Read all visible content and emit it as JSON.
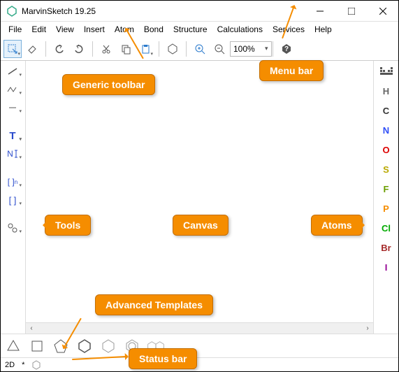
{
  "window": {
    "title": "MarvinSketch 19.25"
  },
  "menu": [
    "File",
    "Edit",
    "View",
    "Insert",
    "Atom",
    "Bond",
    "Structure",
    "Calculations",
    "Services",
    "Help"
  ],
  "toolbar": {
    "zoom": "100%"
  },
  "atoms": [
    {
      "sym": "H",
      "cls": "atom-h"
    },
    {
      "sym": "C",
      "cls": "atom-c"
    },
    {
      "sym": "N",
      "cls": "atom-n"
    },
    {
      "sym": "O",
      "cls": "atom-o"
    },
    {
      "sym": "S",
      "cls": "atom-s"
    },
    {
      "sym": "F",
      "cls": "atom-f"
    },
    {
      "sym": "P",
      "cls": "atom-p"
    },
    {
      "sym": "Cl",
      "cls": "atom-cl"
    },
    {
      "sym": "Br",
      "cls": "atom-br"
    },
    {
      "sym": "I",
      "cls": "atom-i"
    }
  ],
  "left_tools": {
    "text_t": "T",
    "name_n": "N",
    "bracket_n": "[ ]",
    "bracket": "[ ]"
  },
  "status": {
    "mode": "2D",
    "mark": "*"
  },
  "callouts": {
    "menubar": "Menu bar",
    "toolbar": "Generic toolbar",
    "tools": "Tools",
    "canvas": "Canvas",
    "atoms": "Atoms",
    "templates": "Advanced Templates",
    "status": "Status bar"
  }
}
